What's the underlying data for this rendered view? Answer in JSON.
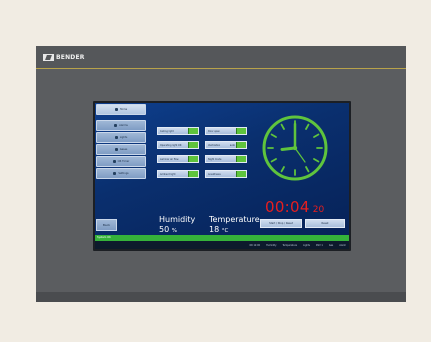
{
  "brand": {
    "name": "BENDER"
  },
  "menu": {
    "items": [
      {
        "label": "Home",
        "icon": "home-icon",
        "active": true
      },
      {
        "label": "Alarms",
        "icon": "bell-icon",
        "active": false
      },
      {
        "label": "Lights",
        "icon": "bulb-icon",
        "active": false
      },
      {
        "label": "Gases",
        "icon": "gas-icon",
        "active": false
      },
      {
        "label": "OR Timer",
        "icon": "timer-icon",
        "active": false
      },
      {
        "label": "Settings",
        "icon": "gear-icon",
        "active": false
      }
    ],
    "back_label": "Back"
  },
  "controls": {
    "left": [
      {
        "label": "Ceiling light",
        "state": "on"
      },
      {
        "label": "Operating light OR",
        "state": "on"
      },
      {
        "label": "Laminar air flow",
        "state": "on"
      },
      {
        "label": "Ambient light",
        "state": "on"
      }
    ],
    "right": [
      {
        "label": "Door open",
        "value": "",
        "state": "on"
      },
      {
        "label": "Ventilation",
        "value": "auto",
        "state": "on"
      },
      {
        "label": "Night mode",
        "value": "",
        "state": "on"
      },
      {
        "label": "Anesthesia",
        "value": "",
        "state": "on"
      }
    ]
  },
  "readouts": {
    "humidity": {
      "label": "Humidity",
      "value": "50",
      "unit": "%"
    },
    "temperature": {
      "label": "Temperature",
      "value": "18",
      "unit": "°C"
    }
  },
  "timer": {
    "hm": "00:04",
    "sec": "20"
  },
  "actions": {
    "start_label": "Start / Stop / Reset",
    "reset_label": "Reset"
  },
  "status": {
    "message": "System OK",
    "items": [
      "OR 12:00",
      "Humidity",
      "Temperature",
      "Lights",
      "RSV 1",
      "Gas",
      "Alarm"
    ]
  },
  "colors": {
    "accent_green": "#5fc43d",
    "timer_red": "#e81e1e",
    "screen_blue": "#0a2f6e"
  }
}
